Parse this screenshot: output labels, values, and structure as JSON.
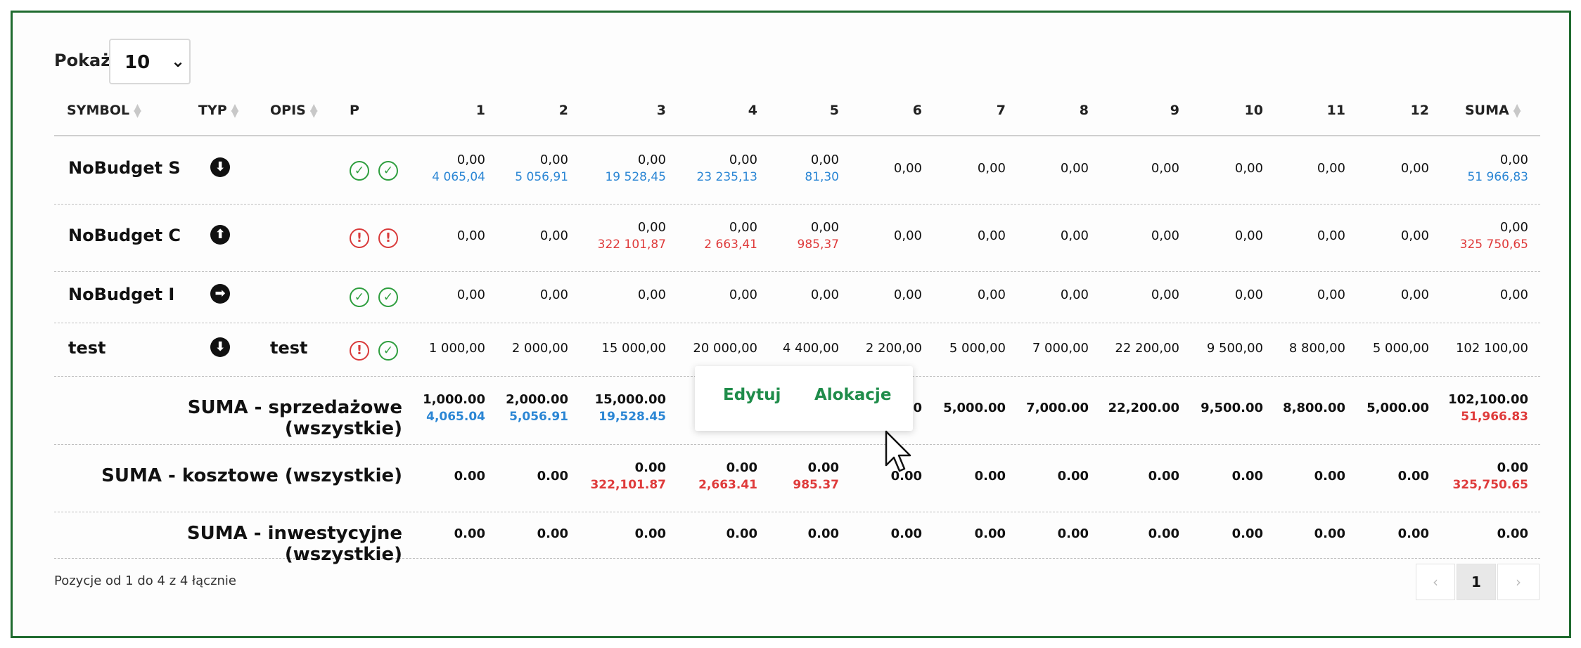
{
  "length_menu": {
    "label": "Pokaż",
    "value": "10",
    "chevron_icon": "chevron-down-icon"
  },
  "columns": {
    "symbol": "SYMBOL",
    "typ": "TYP",
    "opis": "OPIS",
    "p": "P",
    "months": [
      "1",
      "2",
      "3",
      "4",
      "5",
      "6",
      "7",
      "8",
      "9",
      "10",
      "11",
      "12"
    ],
    "suma": "SUMA"
  },
  "rows": [
    {
      "symbol": "NoBudget S",
      "typ_icon": "arrow-down-icon",
      "opis": "",
      "p": [
        "check-icon",
        "check-icon"
      ],
      "cells": [
        {
          "main": "0,00",
          "sub": "4 065,04",
          "sub_color": "blue"
        },
        {
          "main": "0,00",
          "sub": "5 056,91",
          "sub_color": "blue"
        },
        {
          "main": "0,00",
          "sub": "19 528,45",
          "sub_color": "blue"
        },
        {
          "main": "0,00",
          "sub": "23 235,13",
          "sub_color": "blue"
        },
        {
          "main": "0,00",
          "sub": "81,30",
          "sub_color": "blue"
        },
        {
          "main": "0,00"
        },
        {
          "main": "0,00"
        },
        {
          "main": "0,00"
        },
        {
          "main": "0,00"
        },
        {
          "main": "0,00"
        },
        {
          "main": "0,00"
        },
        {
          "main": "0,00"
        }
      ],
      "suma": {
        "main": "0,00",
        "sub": "51 966,83",
        "sub_color": "blue"
      }
    },
    {
      "symbol": "NoBudget C",
      "typ_icon": "arrow-up-icon",
      "opis": "",
      "p": [
        "warning-icon",
        "warning-icon"
      ],
      "cells": [
        {
          "main": "0,00"
        },
        {
          "main": "0,00"
        },
        {
          "main": "0,00",
          "sub": "322 101,87",
          "sub_color": "red"
        },
        {
          "main": "0,00",
          "sub": "2 663,41",
          "sub_color": "red"
        },
        {
          "main": "0,00",
          "sub": "985,37",
          "sub_color": "red"
        },
        {
          "main": "0,00"
        },
        {
          "main": "0,00"
        },
        {
          "main": "0,00"
        },
        {
          "main": "0,00"
        },
        {
          "main": "0,00"
        },
        {
          "main": "0,00"
        },
        {
          "main": "0,00"
        }
      ],
      "suma": {
        "main": "0,00",
        "sub": "325 750,65",
        "sub_color": "red"
      }
    },
    {
      "symbol": "NoBudget I",
      "typ_icon": "arrow-right-icon",
      "opis": "",
      "p": [
        "check-icon",
        "check-icon"
      ],
      "cells": [
        {
          "main": "0,00"
        },
        {
          "main": "0,00"
        },
        {
          "main": "0,00"
        },
        {
          "main": "0,00"
        },
        {
          "main": "0,00"
        },
        {
          "main": "0,00"
        },
        {
          "main": "0,00"
        },
        {
          "main": "0,00"
        },
        {
          "main": "0,00"
        },
        {
          "main": "0,00"
        },
        {
          "main": "0,00"
        },
        {
          "main": "0,00"
        }
      ],
      "suma": {
        "main": "0,00"
      }
    },
    {
      "symbol": "test",
      "typ_icon": "arrow-down-icon",
      "opis": "test",
      "p": [
        "warning-icon",
        "check-icon"
      ],
      "cells": [
        {
          "main": "1 000,00"
        },
        {
          "main": "2 000,00"
        },
        {
          "main": "15 000,00"
        },
        {
          "main": "20 000,00"
        },
        {
          "main": "4 400,00"
        },
        {
          "main": "2 200,00"
        },
        {
          "main": "5 000,00"
        },
        {
          "main": "7 000,00"
        },
        {
          "main": "22 200,00"
        },
        {
          "main": "9 500,00"
        },
        {
          "main": "8 800,00"
        },
        {
          "main": "5 000,00"
        }
      ],
      "suma": {
        "main": "102 100,00"
      }
    }
  ],
  "sums": [
    {
      "label": "SUMA - sprzedażowe (wszystkie)",
      "cells": [
        {
          "main": "1,000.00",
          "sub": "4,065.04",
          "sub_color": "blue"
        },
        {
          "main": "2,000.00",
          "sub": "5,056.91",
          "sub_color": "blue"
        },
        {
          "main": "15,000.00",
          "sub": "19,528.45",
          "sub_color": "blue"
        },
        {
          "main": ""
        },
        {
          "main": ""
        },
        {
          "main": "00"
        },
        {
          "main": "5,000.00"
        },
        {
          "main": "7,000.00"
        },
        {
          "main": "22,200.00"
        },
        {
          "main": "9,500.00"
        },
        {
          "main": "8,800.00"
        },
        {
          "main": "5,000.00"
        }
      ],
      "suma": {
        "main": "102,100.00",
        "sub": "51,966.83",
        "sub_color": "red"
      }
    },
    {
      "label": "SUMA - kosztowe (wszystkie)",
      "cells": [
        {
          "main": "0.00"
        },
        {
          "main": "0.00"
        },
        {
          "main": "0.00",
          "sub": "322,101.87",
          "sub_color": "red"
        },
        {
          "main": "0.00",
          "sub": "2,663.41",
          "sub_color": "red"
        },
        {
          "main": "0.00",
          "sub": "985.37",
          "sub_color": "red"
        },
        {
          "main": "0.00"
        },
        {
          "main": "0.00"
        },
        {
          "main": "0.00"
        },
        {
          "main": "0.00"
        },
        {
          "main": "0.00"
        },
        {
          "main": "0.00"
        },
        {
          "main": "0.00"
        }
      ],
      "suma": {
        "main": "0.00",
        "sub": "325,750.65",
        "sub_color": "red"
      }
    },
    {
      "label": "SUMA - inwestycyjne (wszystkie)",
      "cells": [
        {
          "main": "0.00"
        },
        {
          "main": "0.00"
        },
        {
          "main": "0.00"
        },
        {
          "main": "0.00"
        },
        {
          "main": "0.00"
        },
        {
          "main": "0.00"
        },
        {
          "main": "0.00"
        },
        {
          "main": "0.00"
        },
        {
          "main": "0.00"
        },
        {
          "main": "0.00"
        },
        {
          "main": "0.00"
        },
        {
          "main": "0.00"
        }
      ],
      "suma": {
        "main": "0.00"
      }
    }
  ],
  "footer": {
    "info": "Pozycje od 1 do 4 z 4 łącznie"
  },
  "pagination": {
    "prev": "‹",
    "current": "1",
    "next": "›"
  },
  "context_menu": {
    "edit": "Edytuj",
    "allocations": "Alokacje"
  },
  "colors": {
    "positive": "#2b86d4",
    "negative": "#df3b3b",
    "ok": "#2e9e3e",
    "border": "#1f6b2f",
    "link": "#1f8c4a"
  }
}
